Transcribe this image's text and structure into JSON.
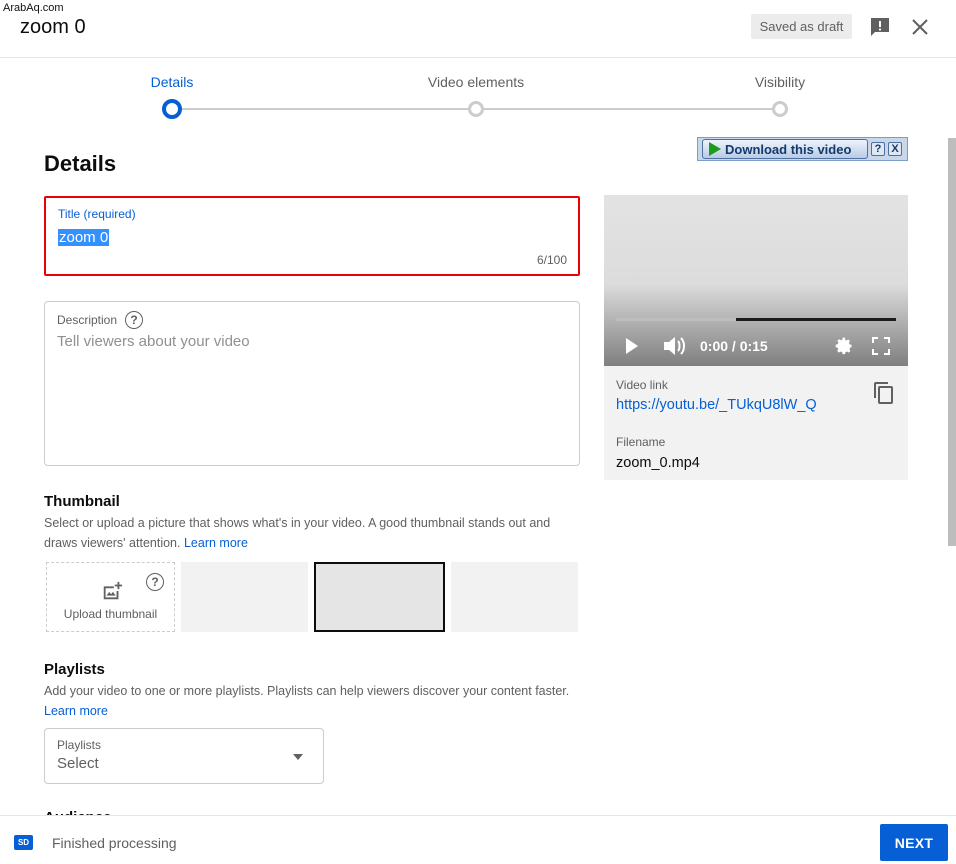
{
  "watermark": "ArabAq.com",
  "header": {
    "title": "zoom 0",
    "draft_status": "Saved as draft"
  },
  "stepper": {
    "steps": [
      {
        "label": "Details",
        "active": true
      },
      {
        "label": "Video elements",
        "active": false
      },
      {
        "label": "Visibility",
        "active": false
      }
    ]
  },
  "download_bar": {
    "button_label": "Download this video",
    "help": "?",
    "close": "X"
  },
  "details": {
    "heading": "Details",
    "title_field": {
      "label": "Title (required)",
      "value": "zoom 0",
      "counter": "6/100"
    },
    "description_field": {
      "label": "Description",
      "placeholder": "Tell viewers about your video"
    }
  },
  "thumbnail": {
    "heading": "Thumbnail",
    "description": "Select or upload a picture that shows what's in your video. A good thumbnail stands out and draws viewers' attention.",
    "learn_more": "Learn more",
    "upload_label": "Upload thumbnail"
  },
  "playlists": {
    "heading": "Playlists",
    "description": "Add your video to one or more playlists. Playlists can help viewers discover your content faster.",
    "learn_more": "Learn more",
    "field_label": "Playlists",
    "selected": "Select"
  },
  "video_preview": {
    "time": "0:00 / 0:15",
    "progress_loaded_fraction": 0.57,
    "link_label": "Video link",
    "link_url": "https://youtu.be/_TUkqU8lW_Q",
    "filename_label": "Filename",
    "filename": "zoom_0.mp4"
  },
  "footer": {
    "badge": "SD",
    "status": "Finished processing",
    "next_label": "NEXT"
  },
  "colors": {
    "accent": "#065fd4",
    "highlight_border": "#ee0000"
  }
}
